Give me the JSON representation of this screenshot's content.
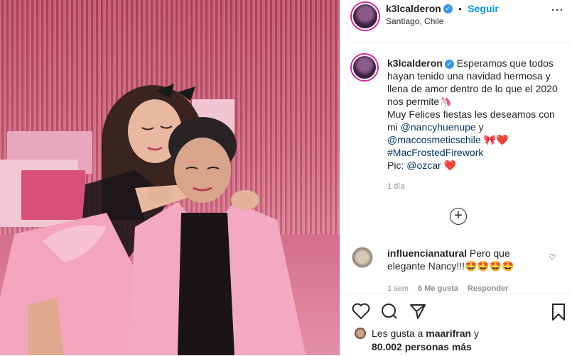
{
  "post": {
    "username": "k3lcalderon",
    "verified_symbol": "✓",
    "separator": "•",
    "follow_label": "Seguir",
    "location": "Santiago, Chile",
    "more_symbol": "⋯"
  },
  "caption": {
    "username": "k3lcalderon",
    "text_1": "Esperamos que todos hayan tenido una navidad hermosa y llena de amor dentro de lo que el 2020 nos permite🦄",
    "text_2": "Muy Felices fiestas les deseamos con mi",
    "mention_1": "@nancyhuenupe",
    "text_3": "y",
    "mention_2": "@maccosmeticschile",
    "emoji_1": "🎀❤️",
    "hashtag": "#MacFrostedFirework",
    "pic_label": "Pic:",
    "mention_3": "@ozcar",
    "emoji_2": "❤️",
    "time": "1 día"
  },
  "load_more_symbol": "+",
  "comment": {
    "username": "influencianatural",
    "text": "Pero que elegante Nancy!!!🤩🤩🤩🤩",
    "time": "1 sem",
    "likes": "6 Me gusta",
    "reply_label": "Responder"
  },
  "likes": {
    "prefix": "Les gusta a",
    "user": "maarifran",
    "connector": "y",
    "count_text": "80.002 personas más"
  },
  "icons": {
    "like": "heart-icon",
    "comment": "comment-icon",
    "share": "share-icon",
    "save": "bookmark-icon",
    "colors": {
      "accent": "#0095f6",
      "verified": "#3897f0",
      "ring": "#d6249f",
      "link": "#00376b"
    }
  }
}
